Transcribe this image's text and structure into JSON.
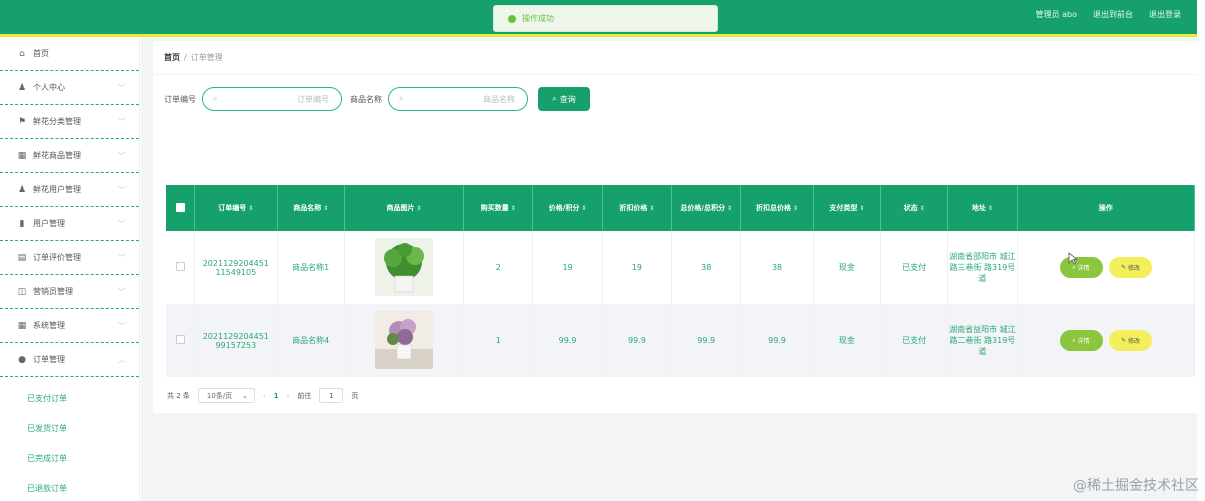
{
  "header": {
    "toast_text": "操作成功",
    "user_label": "管理员 abo",
    "back_home": "退出到前台",
    "logout": "退出登录",
    "colors": {
      "primary": "#16a06c",
      "accent_line": "#e6e83a"
    }
  },
  "sidebar": {
    "items": [
      {
        "label": "首页",
        "icon": "home-icon",
        "glyph": "⌂"
      },
      {
        "label": "个人中心",
        "icon": "user-icon",
        "glyph": "♟"
      },
      {
        "label": "鲜花分类管理",
        "icon": "flag-icon",
        "glyph": "⚑"
      },
      {
        "label": "鲜花商品管理",
        "icon": "grid-icon",
        "glyph": "▦"
      },
      {
        "label": "鲜花用户管理",
        "icon": "user-icon",
        "glyph": "♟"
      },
      {
        "label": "用户管理",
        "icon": "chart-icon",
        "glyph": "▮"
      },
      {
        "label": "订单评价管理",
        "icon": "table-icon",
        "glyph": "▤"
      },
      {
        "label": "营销员管理",
        "icon": "copy-icon",
        "glyph": "◫"
      },
      {
        "label": "系统管理",
        "icon": "list-icon",
        "glyph": "▦"
      },
      {
        "label": "订单管理",
        "icon": "location-icon",
        "glyph": "●"
      }
    ],
    "submenu": [
      "已支付订单",
      "已发货订单",
      "已完成订单",
      "已退款订单"
    ]
  },
  "breadcrumb": {
    "home": "首页",
    "sep": "/",
    "current": "订单管理"
  },
  "search": {
    "order_label": "订单编号",
    "order_placeholder": "订单编号",
    "goods_label": "商品名称",
    "goods_placeholder": "商品名称",
    "button": "查询"
  },
  "table": {
    "columns": [
      "订单编号",
      "商品名称",
      "商品图片",
      "购买数量",
      "价格/积分",
      "折扣价格",
      "总价格/总积分",
      "折扣总价格",
      "支付类型",
      "状态",
      "地址",
      "操作"
    ],
    "rows": [
      {
        "order_no": "2021129204451 11549105",
        "goods": "商品名称1",
        "qty": "2",
        "price": "19",
        "discount": "19",
        "total": "38",
        "discount_total": "38",
        "pay_type": "现金",
        "status": "已支付",
        "address": "湖南省邵阳市 城江路三巷街 路319号道",
        "detail_btn": "详情",
        "edit_btn": "修改"
      },
      {
        "order_no": "2021129204451 99157253",
        "goods": "商品名称4",
        "qty": "1",
        "price": "99.9",
        "discount": "99.9",
        "total": "99.9",
        "discount_total": "99.9",
        "pay_type": "现金",
        "status": "已支付",
        "address": "湖南省益阳市 城江路二巷街 路319号道",
        "detail_btn": "详情",
        "edit_btn": "修改"
      }
    ]
  },
  "pager": {
    "total": "共 2 条",
    "page_size": "10条/页",
    "current_page": "1",
    "goto_label": "前往",
    "goto_value": "1",
    "page_unit": "页"
  },
  "watermark": "@稀土掘金技术社区"
}
